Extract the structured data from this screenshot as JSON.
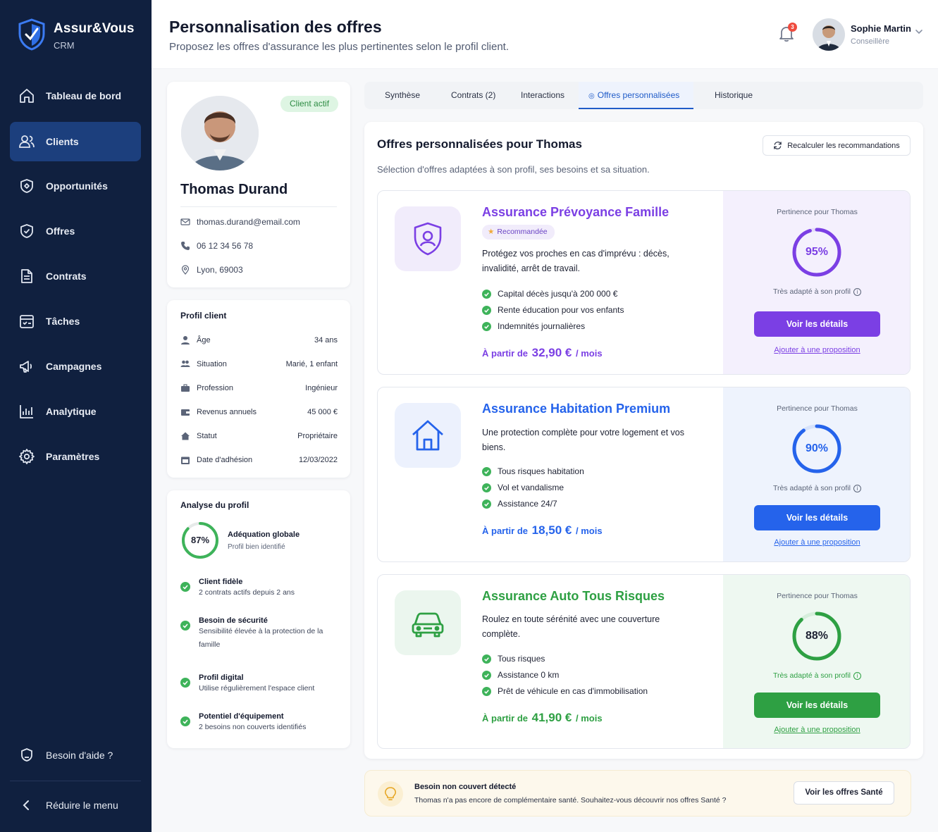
{
  "brand": {
    "name": "Assur&Vous",
    "sub": "CRM"
  },
  "sidebar": {
    "items": [
      {
        "label": "Tableau de bord",
        "icon": "home-icon"
      },
      {
        "label": "Clients",
        "icon": "users-icon",
        "active": true
      },
      {
        "label": "Opportunités",
        "icon": "tag-icon"
      },
      {
        "label": "Offres",
        "icon": "shield-check-icon"
      },
      {
        "label": "Contrats",
        "icon": "document-icon"
      },
      {
        "label": "Tâches",
        "icon": "checklist-icon"
      },
      {
        "label": "Campagnes",
        "icon": "megaphone-icon"
      },
      {
        "label": "Analytique",
        "icon": "bar-chart-icon"
      },
      {
        "label": "Paramètres",
        "icon": "gear-icon"
      }
    ],
    "help": "Besoin d'aide ?",
    "collapse": "Réduire le menu"
  },
  "header": {
    "title": "Personnalisation des offres",
    "subtitle": "Proposez les offres d'assurance les plus pertinentes selon le profil client.",
    "notifications": "3",
    "user_name": "Sophie Martin",
    "user_role": "Conseillère"
  },
  "client": {
    "status": "Client actif",
    "name": "Thomas Durand",
    "email": "thomas.durand@email.com",
    "phone": "06 12 34 56 78",
    "location": "Lyon, 69003"
  },
  "profile": {
    "title": "Profil client",
    "rows": [
      {
        "label": "Âge",
        "value": "34 ans"
      },
      {
        "label": "Situation",
        "value": "Marié, 1 enfant"
      },
      {
        "label": "Profession",
        "value": "Ingénieur"
      },
      {
        "label": "Revenus annuels",
        "value": "45 000 €"
      },
      {
        "label": "Statut",
        "value": "Propriétaire"
      },
      {
        "label": "Date d'adhésion",
        "value": "12/03/2022"
      }
    ]
  },
  "analysis": {
    "title": "Analyse du profil",
    "score": "87%",
    "score_value": 87,
    "score_title": "Adéquation globale",
    "score_sub": "Profil bien identifié",
    "insights": [
      {
        "title": "Client fidèle",
        "desc": "2 contrats actifs depuis 2 ans"
      },
      {
        "title": "Besoin de sécurité",
        "desc": "Sensibilité élevée à la protection de la famille"
      },
      {
        "title": "Profil digital",
        "desc": "Utilise régulièrement l'espace client"
      },
      {
        "title": "Potentiel d'équipement",
        "desc": "2 besoins non couverts identifiés"
      }
    ]
  },
  "tabs": [
    {
      "label": "Synthèse"
    },
    {
      "label": "Contrats (2)"
    },
    {
      "label": "Interactions"
    },
    {
      "label": "Offres personnalisées",
      "active": true
    },
    {
      "label": "Historique"
    }
  ],
  "offers_panel": {
    "title": "Offres personnalisées pour Thomas",
    "subtitle": "Sélection d'offres adaptées à son profil, ses besoins et sa situation.",
    "recalc": "Recalculer les recommandations"
  },
  "offers": [
    {
      "title": "Assurance Prévoyance Famille",
      "badge": "Recommandée",
      "desc": "Protégez vos proches en cas d'imprévu : décès, invalidité, arrêt de travail.",
      "features": [
        "Capital décès jusqu'à 200 000 €",
        "Rente éducation pour vos enfants",
        "Indemnités journalières"
      ],
      "price_prefix": "À partir de",
      "price": "32,90 €",
      "price_suffix": "/ mois",
      "pertinence_label": "Pertinence pour Thomas",
      "score": "95%",
      "score_value": 95,
      "adapt": "Très adapté à son profil",
      "details": "Voir les détails",
      "add": "Ajouter à une proposition",
      "color": "#7b3fe4",
      "icon": "shield-person-icon"
    },
    {
      "title": "Assurance Habitation Premium",
      "desc": "Une protection complète pour votre logement et vos biens.",
      "features": [
        "Tous risques habitation",
        "Vol et vandalisme",
        "Assistance 24/7"
      ],
      "price_prefix": "À partir de",
      "price": "18,50 €",
      "price_suffix": "/ mois",
      "pertinence_label": "Pertinence pour Thomas",
      "score": "90%",
      "score_value": 90,
      "adapt": "Très adapté à son profil",
      "details": "Voir les détails",
      "add": "Ajouter à une proposition",
      "color": "#2563eb",
      "icon": "house-icon"
    },
    {
      "title": "Assurance Auto Tous Risques",
      "desc": "Roulez en toute sérénité avec une couverture complète.",
      "features": [
        "Tous risques",
        "Assistance 0 km",
        "Prêt de véhicule en cas d'immobilisation"
      ],
      "price_prefix": "À partir de",
      "price": "41,90 €",
      "price_suffix": "/ mois",
      "pertinence_label": "Pertinence pour Thomas",
      "score": "88%",
      "score_value": 88,
      "adapt": "Très adapté à son profil",
      "details": "Voir les détails",
      "add": "Ajouter à une proposition",
      "color": "#2ea043",
      "icon": "car-icon"
    }
  ],
  "alert": {
    "title": "Besoin non couvert détecté",
    "desc": "Thomas n'a pas encore de complémentaire santé. Souhaitez-vous découvrir nos offres Santé ?",
    "button": "Voir les offres Santé"
  }
}
